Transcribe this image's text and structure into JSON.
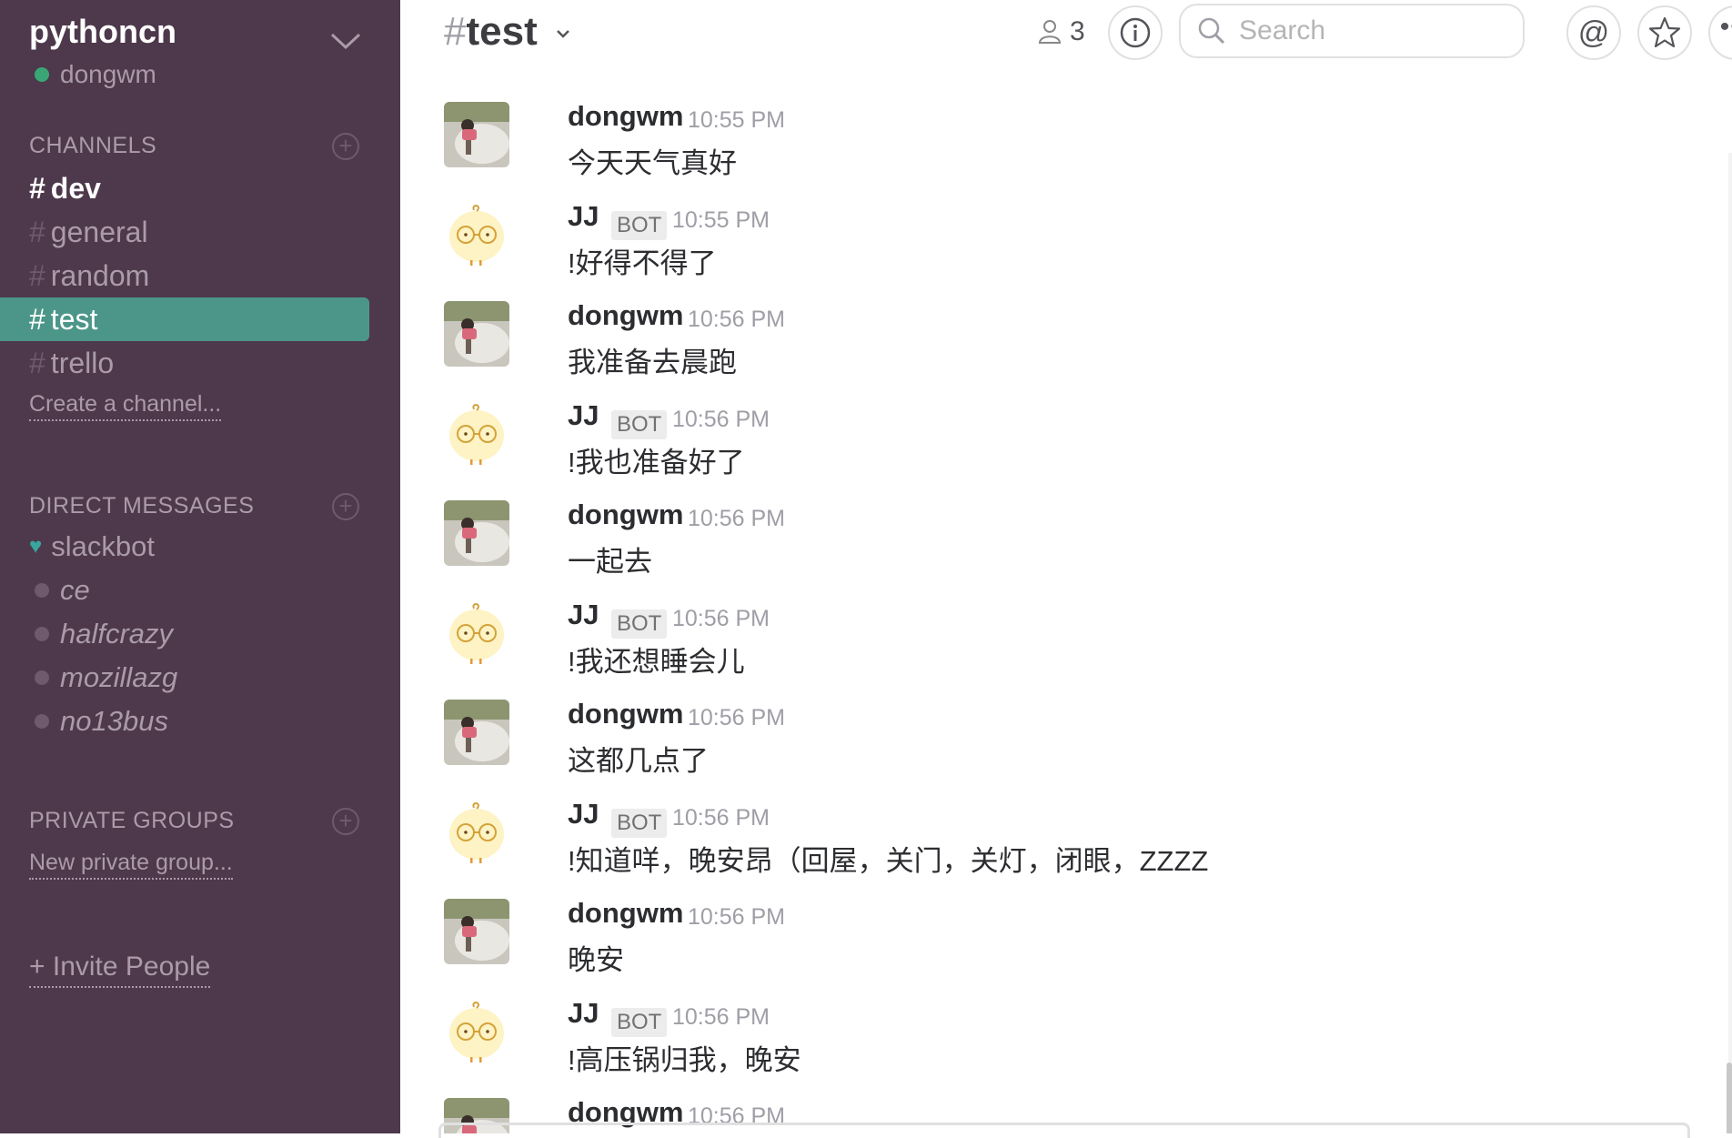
{
  "team": {
    "name": "pythoncn",
    "user": "dongwm"
  },
  "sidebar": {
    "channels_header": "CHANNELS",
    "channels": [
      {
        "name": "dev",
        "state": "unread"
      },
      {
        "name": "general",
        "state": "normal"
      },
      {
        "name": "random",
        "state": "normal"
      },
      {
        "name": "test",
        "state": "active"
      },
      {
        "name": "trello",
        "state": "normal"
      }
    ],
    "hash": "#",
    "create_channel": "Create a channel...",
    "dm_header": "DIRECT MESSAGES",
    "dms": [
      {
        "name": "slackbot",
        "status": "heart"
      },
      {
        "name": "ce",
        "status": "away"
      },
      {
        "name": "halfcrazy",
        "status": "away"
      },
      {
        "name": "mozillazg",
        "status": "away"
      },
      {
        "name": "no13bus",
        "status": "away"
      }
    ],
    "private_header": "PRIVATE GROUPS",
    "new_private_group": "New private group...",
    "invite": "+ Invite People"
  },
  "header": {
    "channel_hash": "#",
    "channel_name": "test",
    "member_count": "3",
    "search_placeholder": "Search"
  },
  "messages": [
    {
      "author": "dongwm",
      "bot": false,
      "time": "10:55 PM",
      "text": "今天天气真好"
    },
    {
      "author": "JJ",
      "bot": true,
      "time": "10:55 PM",
      "text": "!好得不得了"
    },
    {
      "author": "dongwm",
      "bot": false,
      "time": "10:56 PM",
      "text": "我准备去晨跑"
    },
    {
      "author": "JJ",
      "bot": true,
      "time": "10:56 PM",
      "text": "!我也准备好了"
    },
    {
      "author": "dongwm",
      "bot": false,
      "time": "10:56 PM",
      "text": "一起去"
    },
    {
      "author": "JJ",
      "bot": true,
      "time": "10:56 PM",
      "text": "!我还想睡会儿"
    },
    {
      "author": "dongwm",
      "bot": false,
      "time": "10:56 PM",
      "text": "这都几点了"
    },
    {
      "author": "JJ",
      "bot": true,
      "time": "10:56 PM",
      "text": "!知道咩，晚安昂（回屋，关门，关灯，闭眼，ZZZZ"
    },
    {
      "author": "dongwm",
      "bot": false,
      "time": "10:56 PM",
      "text": "晚安"
    },
    {
      "author": "JJ",
      "bot": true,
      "time": "10:56 PM",
      "text": "!高压锅归我，晚安"
    },
    {
      "author": "dongwm",
      "bot": false,
      "time": "10:56 PM",
      "text": ""
    }
  ],
  "bot_tag": "BOT",
  "colors": {
    "sidebar_bg": "#4d394b",
    "active_channel": "#4c9689",
    "presence_online": "#3aa676",
    "sidebar_text": "#ab9ba9"
  }
}
